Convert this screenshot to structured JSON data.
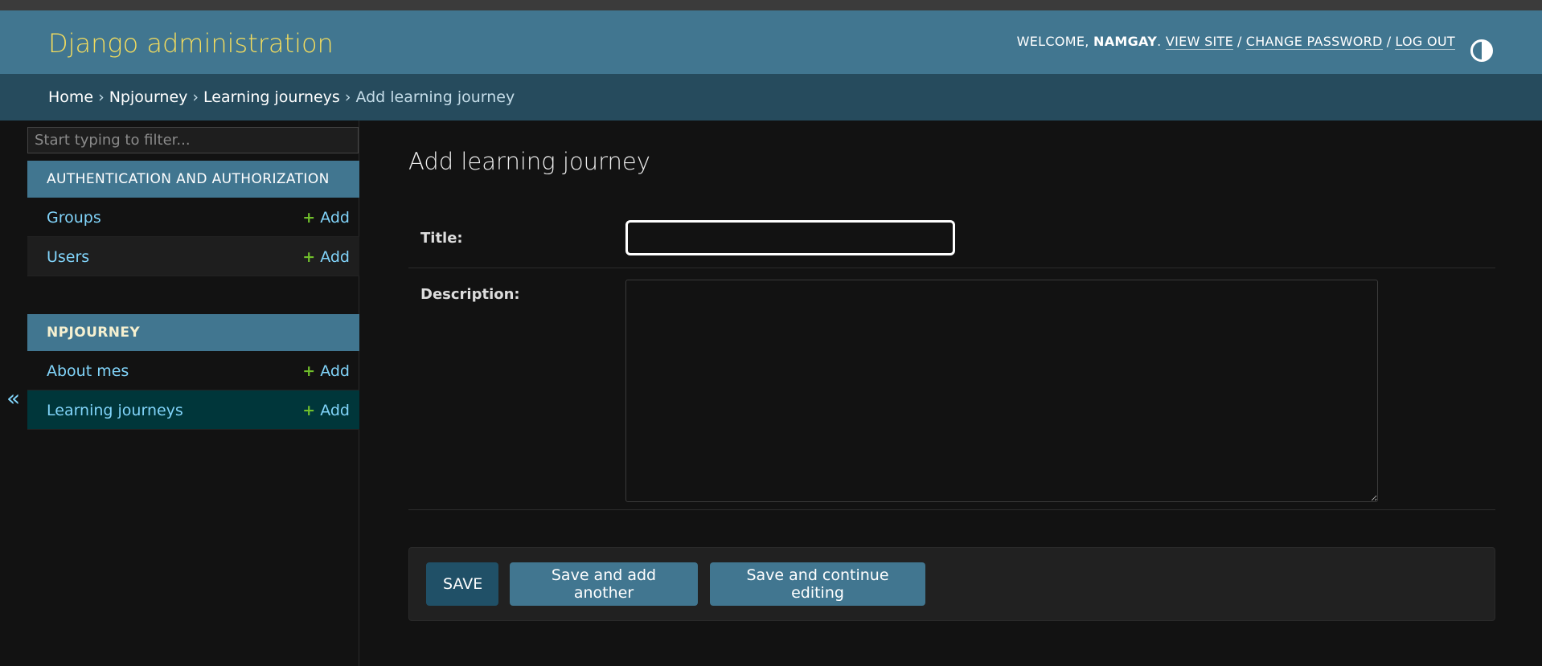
{
  "header": {
    "site_title": "Django administration",
    "welcome_prefix": "WELCOME,",
    "username": "NAMGAY",
    "welcome_suffix": ".",
    "view_site": "VIEW SITE",
    "change_password": "CHANGE PASSWORD",
    "log_out": "LOG OUT",
    "separator": "/",
    "theme_icon": "theme-toggle-icon"
  },
  "breadcrumbs": {
    "items": [
      "Home",
      "Npjourney",
      "Learning journeys"
    ],
    "current": "Add learning journey",
    "separator": "›"
  },
  "sidebar": {
    "filter_placeholder": "Start typing to filter...",
    "apps": [
      {
        "caption": "AUTHENTICATION AND AUTHORIZATION",
        "models": [
          {
            "name": "Groups",
            "add": "Add"
          },
          {
            "name": "Users",
            "add": "Add"
          }
        ]
      },
      {
        "caption": "NPJOURNEY",
        "models": [
          {
            "name": "About mes",
            "add": "Add"
          },
          {
            "name": "Learning journeys",
            "add": "Add"
          }
        ]
      }
    ],
    "add_icon": "+",
    "collapse_icon": "«"
  },
  "main": {
    "title": "Add learning journey",
    "fields": {
      "title_label": "Title:",
      "title_value": "",
      "description_label": "Description:",
      "description_value": ""
    },
    "buttons": {
      "save": "SAVE",
      "save_add_another": "Save and add another",
      "save_continue": "Save and continue editing"
    }
  },
  "colors": {
    "header_bg": "#417690",
    "breadcrumb_bg": "#264b5d",
    "brand_yellow": "#f5dd5d",
    "link_blue": "#81d4fa",
    "add_green": "#70bf2b",
    "current_row": "#00363a"
  }
}
